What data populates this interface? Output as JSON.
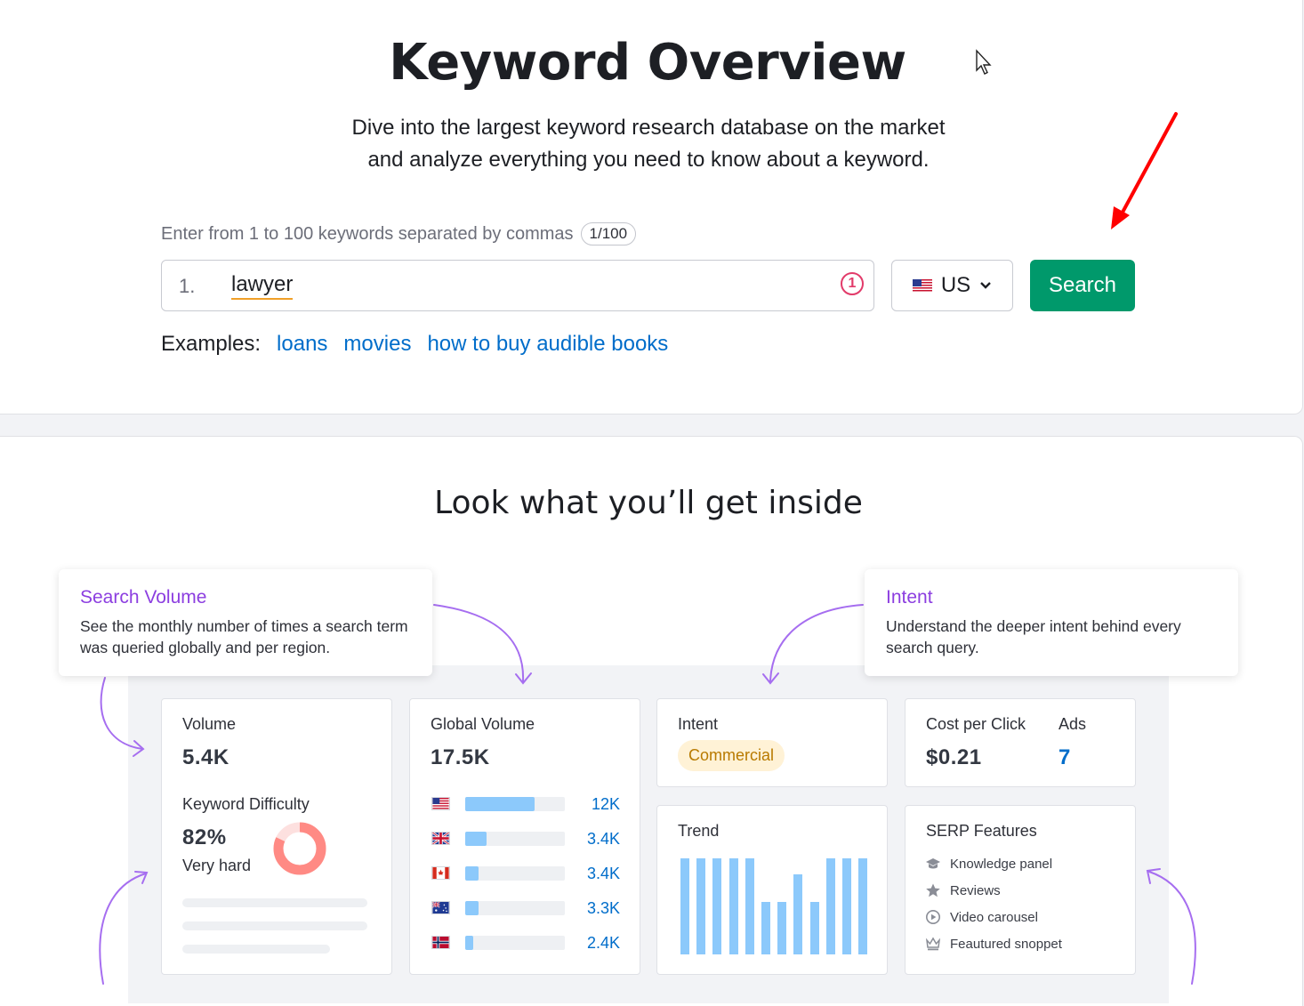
{
  "header": {
    "title": "Keyword Overview",
    "subtitle_line1": "Dive into the largest keyword research database on the market",
    "subtitle_line2": "and analyze everything you need to know about a keyword."
  },
  "search_form": {
    "hint": "Enter from 1 to 100 keywords separated by commas",
    "counter": "1/100",
    "line_number": "1.",
    "keyword_value": "lawyer",
    "keyword_count_badge": "1",
    "country": "US",
    "search_label": "Search",
    "examples_label": "Examples:",
    "examples": [
      "loans",
      "movies",
      "how to buy audible books"
    ]
  },
  "preview": {
    "title": "Look what you’ll get inside",
    "callouts": {
      "search_volume": {
        "title": "Search Volume",
        "text": "See the monthly number of times a search term was queried globally and per region."
      },
      "intent": {
        "title": "Intent",
        "text": "Understand the deeper intent behind every search query."
      }
    },
    "volume_card": {
      "volume_label": "Volume",
      "volume_value": "5.4K",
      "kd_label": "Keyword Difficulty",
      "kd_value": "82%",
      "kd_level": "Very hard",
      "kd_fraction": 0.82
    },
    "global_volume_card": {
      "label": "Global Volume",
      "value": "17.5K",
      "rows": [
        {
          "country": "us-flag",
          "value": "12K",
          "fill": 0.7
        },
        {
          "country": "uk-flag",
          "value": "3.4K",
          "fill": 0.21
        },
        {
          "country": "ca-flag",
          "value": "3.4K",
          "fill": 0.13
        },
        {
          "country": "au-flag",
          "value": "3.3K",
          "fill": 0.13
        },
        {
          "country": "no-flag",
          "value": "2.4K",
          "fill": 0.08
        }
      ]
    },
    "intent_card": {
      "label": "Intent",
      "value": "Commercial"
    },
    "cpc_card": {
      "cpc_label": "Cost per Click",
      "cpc_value": "$0.21",
      "ads_label": "Ads",
      "ads_value": "7"
    },
    "trend_card": {
      "label": "Trend",
      "values": [
        1,
        1,
        1,
        1,
        1,
        0.55,
        0.55,
        0.83,
        0.55,
        1,
        1,
        1
      ]
    },
    "serp_card": {
      "label": "SERP Features",
      "items": [
        {
          "icon": "graduation-cap-icon",
          "label": "Knowledge panel"
        },
        {
          "icon": "star-icon",
          "label": "Reviews"
        },
        {
          "icon": "play-circle-icon",
          "label": "Video carousel"
        },
        {
          "icon": "crown-icon",
          "label": "Feautured snoppet"
        }
      ]
    }
  },
  "colors": {
    "accent_green": "#00996b",
    "link_blue": "#006dca",
    "callout_purple": "#8c3ee0",
    "bar_blue": "#8cc9fb",
    "kd_donut": "#ff8a84",
    "annotation_arrow": "#ff0000"
  }
}
